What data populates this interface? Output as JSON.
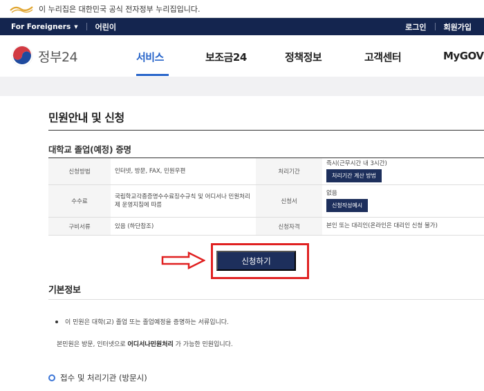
{
  "gov_banner": {
    "text": "이 누리집은 대한민국 공식 전자정부 누리집입니다."
  },
  "util_bar": {
    "foreigners": "For Foreigners",
    "kids": "어린이",
    "login": "로그인",
    "signup": "회원가입"
  },
  "header": {
    "logo_text": "정부24",
    "nav": [
      {
        "label": "서비스"
      },
      {
        "label": "보조금24"
      },
      {
        "label": "정책정보"
      },
      {
        "label": "고객센터"
      },
      {
        "label": "MyGOV"
      }
    ]
  },
  "page": {
    "title": "민원안내 및 신청",
    "service_title": "대학교 졸업(예정) 증명",
    "table": {
      "r1": {
        "h1": "신청방법",
        "v1": "인터넷, 방문, FAX, 민원우편",
        "h2": "처리기간",
        "v2": "즉시(근무시간 내 3시간)",
        "btn": "처리기간 계산 방법"
      },
      "r2": {
        "h1": "수수료",
        "v1": "국립학교각종증명수수료징수규칙 및 어디서나 민원처리제 운영지침에 따름",
        "h2": "신청서",
        "v2": "없음",
        "btn": "신청작성예시"
      },
      "r3": {
        "h1": "구비서류",
        "v1": "있음 (하단참조)",
        "h2": "신청자격",
        "v2": "본인 또는 대리인(온라인은 대리인 신청 불가)"
      }
    },
    "apply_button": "신청하기",
    "basic_info_title": "기본정보",
    "bullet_text": "이 민원은 대학(교) 졸업 또는 졸업예정을 증명하는 서류입니다.",
    "para_prefix": "본민원은 방문, 인터넷으로 ",
    "para_bold": "어디서나민원처리",
    "para_suffix": " 가 가능한 민원입니다.",
    "sub_title": "접수 및 처리기관 (방문시)"
  },
  "colors": {
    "navy": "#14254f",
    "button_navy": "#1d2f5c",
    "accent_blue": "#2563c9",
    "highlight_red": "#e02020"
  }
}
